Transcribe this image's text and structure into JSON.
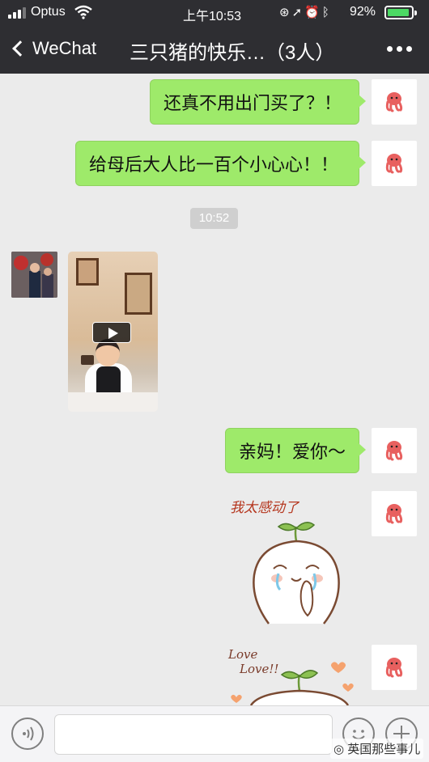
{
  "status_bar": {
    "carrier": "Optus",
    "time": "上午10:53",
    "battery_percent": "92%",
    "battery_level": 0.92
  },
  "nav": {
    "back_label": "WeChat",
    "title": "三只猪的快乐…（3人）"
  },
  "messages": {
    "m1": "还真不用出门买了？！",
    "m2": "给母后大人比一百个小心心！！",
    "timestamp": "10:52",
    "m3": "亲妈！爱你～"
  },
  "stickers": {
    "sticker1_text": "我太感动了",
    "sticker2_text1": "Love",
    "sticker2_text2": "Love!!"
  },
  "input": {
    "value": "",
    "placeholder": ""
  },
  "watermark": "英国那些事儿",
  "colors": {
    "topbar": "#2e2e32",
    "chat_background": "#ebebeb",
    "self_bubble": "#9eea6a",
    "accent_battery": "#4cd964"
  },
  "icons": [
    "signal-icon",
    "wifi-icon",
    "lock-rotation-icon",
    "location-icon",
    "alarm-icon",
    "bluetooth-icon",
    "battery-icon",
    "back-chevron-icon",
    "more-icon",
    "play-icon",
    "voice-icon",
    "emoji-icon",
    "plus-icon"
  ]
}
